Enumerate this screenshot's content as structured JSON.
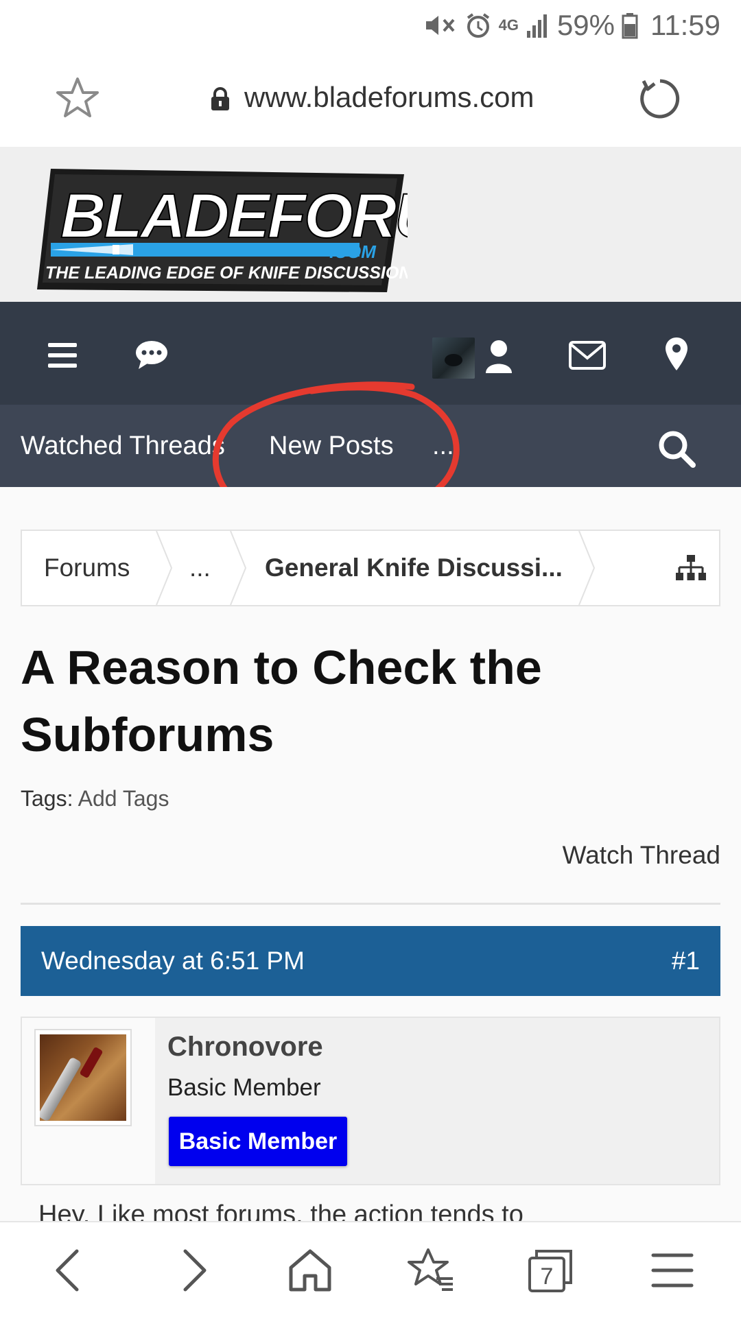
{
  "status_bar": {
    "network": "4G",
    "battery": "59%",
    "time": "11:59"
  },
  "browser": {
    "url": "www.bladeforums.com"
  },
  "nav_secondary": {
    "watched_threads": "Watched Threads",
    "new_posts": "New Posts",
    "more": "..."
  },
  "breadcrumb": {
    "items": [
      "Forums",
      "...",
      "General Knife Discussi..."
    ]
  },
  "thread": {
    "title": "A Reason to Check the Subforums",
    "tags_label": "Tags:",
    "add_tags": "Add Tags",
    "watch_label": "Watch Thread"
  },
  "post": {
    "date": "Wednesday at 6:51 PM",
    "number": "#1",
    "username": "Chronovore",
    "user_title": "Basic Member",
    "user_badge": "Basic Member",
    "body_preview": "Hey. Like most forums, the action tends to"
  },
  "bottom_bar": {
    "tabs_count": "7"
  },
  "colors": {
    "nav_primary": "#333b48",
    "nav_secondary": "#3e4655",
    "post_header": "#1c6096",
    "badge": "#0000ee",
    "annotation": "#e53a2f"
  }
}
